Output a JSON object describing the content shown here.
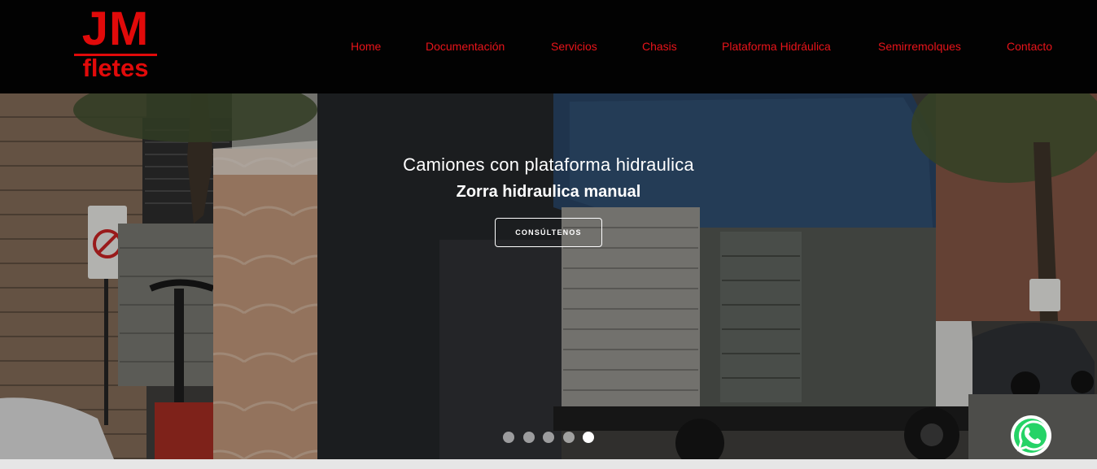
{
  "brand": {
    "line1": "JM",
    "line2": "fletes",
    "color": "#e10a0a"
  },
  "nav": {
    "items": [
      {
        "label": "Home"
      },
      {
        "label": "Documentación"
      },
      {
        "label": "Servicios"
      },
      {
        "label": "Chasis"
      },
      {
        "label": "Plataforma Hidráulica"
      },
      {
        "label": "Semirremolques"
      },
      {
        "label": "Contacto"
      }
    ],
    "color": "#e8141a"
  },
  "hero": {
    "title": "Camiones con plataforma hidraulica",
    "subtitle": "Zorra hidraulica manual",
    "cta_label": "CONSÚLTENOS",
    "slides_count": 5,
    "active_slide": 5
  },
  "floating": {
    "icon": "whatsapp-icon",
    "color": "#25d366"
  }
}
